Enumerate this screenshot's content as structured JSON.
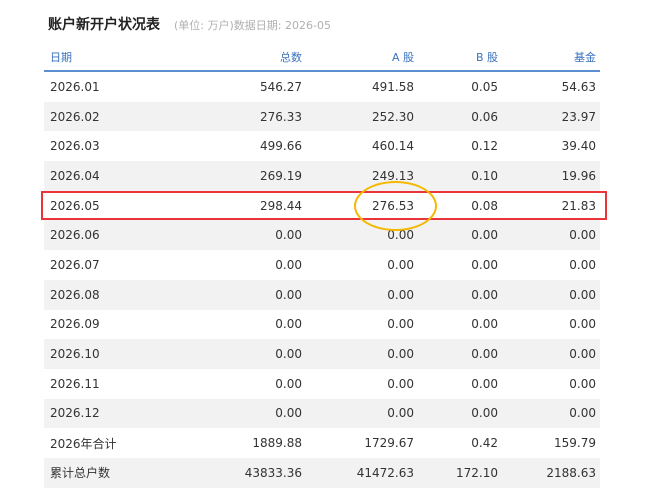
{
  "header": {
    "title": "账户新开户状况表",
    "subtitle": "(单位: 万户)数据日期: 2026-05"
  },
  "table": {
    "columns": [
      "日期",
      "总数",
      "A 股",
      "B 股",
      "基金"
    ],
    "rows": [
      [
        "2026.01",
        "546.27",
        "491.58",
        "0.05",
        "54.63"
      ],
      [
        "2026.02",
        "276.33",
        "252.30",
        "0.06",
        "23.97"
      ],
      [
        "2026.03",
        "499.66",
        "460.14",
        "0.12",
        "39.40"
      ],
      [
        "2026.04",
        "269.19",
        "249.13",
        "0.10",
        "19.96"
      ],
      [
        "2026.05",
        "298.44",
        "276.53",
        "0.08",
        "21.83"
      ],
      [
        "2026.06",
        "0.00",
        "0.00",
        "0.00",
        "0.00"
      ],
      [
        "2026.07",
        "0.00",
        "0.00",
        "0.00",
        "0.00"
      ],
      [
        "2026.08",
        "0.00",
        "0.00",
        "0.00",
        "0.00"
      ],
      [
        "2026.09",
        "0.00",
        "0.00",
        "0.00",
        "0.00"
      ],
      [
        "2026.10",
        "0.00",
        "0.00",
        "0.00",
        "0.00"
      ],
      [
        "2026.11",
        "0.00",
        "0.00",
        "0.00",
        "0.00"
      ],
      [
        "2026.12",
        "0.00",
        "0.00",
        "0.00",
        "0.00"
      ],
      [
        "2026年合计",
        "1889.88",
        "1729.67",
        "0.42",
        "159.79"
      ],
      [
        "累计总户数",
        "43833.36",
        "41472.63",
        "172.10",
        "2188.63"
      ]
    ]
  },
  "annotations": {
    "highlight_row": "2026.05",
    "highlight_cell": "276.53",
    "rect_color": "#e8343a",
    "ellipse_color": "#f5b800"
  },
  "colors": {
    "header_text": "#3a72bd",
    "header_rule": "#5b8fd0",
    "alt_row_bg": "#f2f2f2"
  }
}
